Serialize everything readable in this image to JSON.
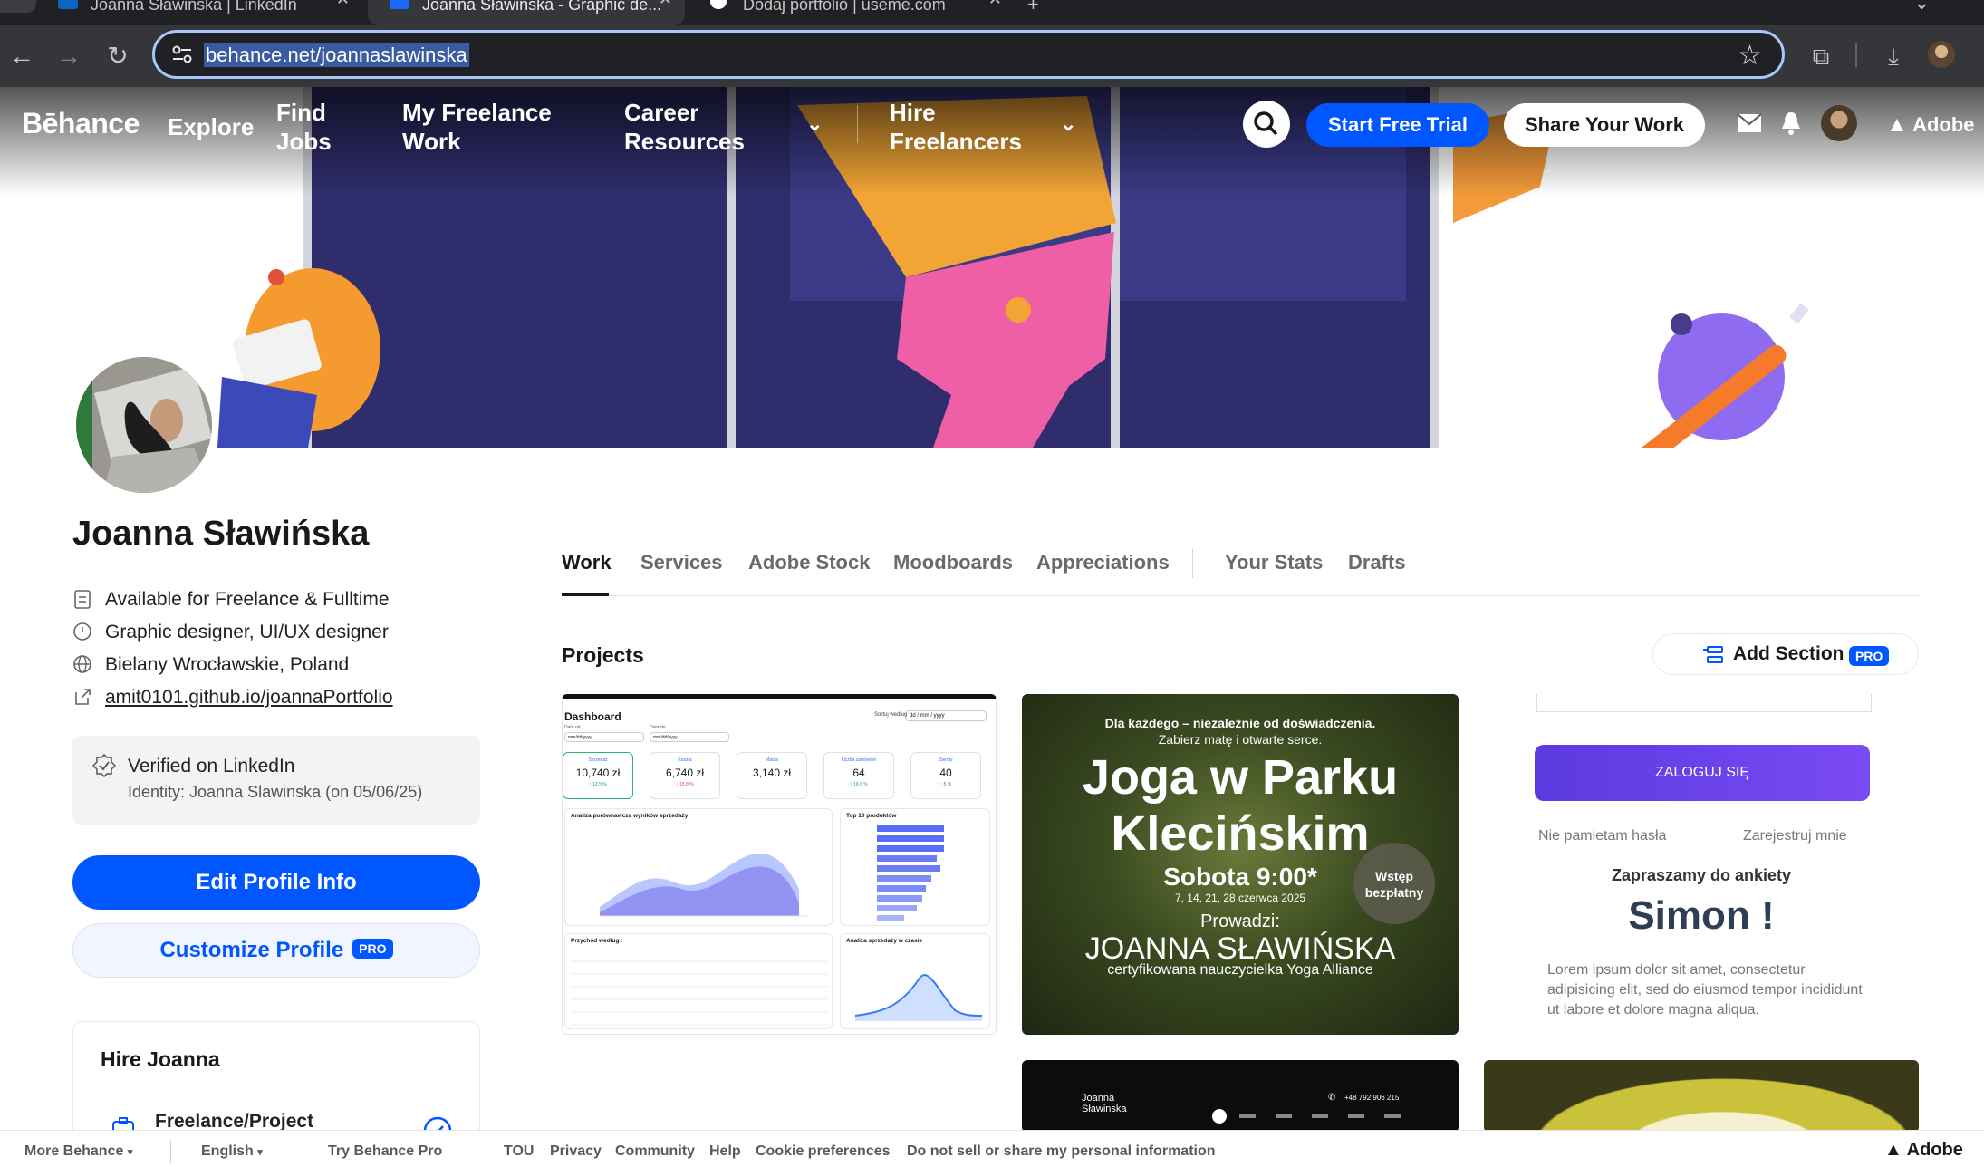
{
  "browser": {
    "tabs": [
      {
        "title": "Joanna Sławińska | LinkedIn"
      },
      {
        "title": "Joanna Sławińska - Graphic de..."
      },
      {
        "title": "Dodaj portfolio | useme.com"
      }
    ],
    "url": "behance.net/joannaslawinska",
    "icons": [
      "back-arrow-icon",
      "forward-arrow-icon",
      "reload-icon",
      "star-icon",
      "extensions-icon",
      "download-icon"
    ]
  },
  "behance_nav": {
    "logo": "Bēhance",
    "explore": "Explore",
    "find_jobs": [
      "Find",
      "Jobs"
    ],
    "freelance": [
      "My Freelance",
      "Work"
    ],
    "career": [
      "Career",
      "Resources"
    ],
    "hire": [
      "Hire",
      "Freelancers"
    ],
    "start_trial": "Start Free Trial",
    "share_work": "Share Your Work",
    "adobe": "Adobe"
  },
  "profile": {
    "name": "Joanna Sławińska",
    "availability": "Available for Freelance & Fulltime",
    "occupation": "Graphic designer, UI/UX designer",
    "location": "Bielany Wrocławskie, Poland",
    "website": "amit0101.github.io/joannaPortfolio",
    "verified_title": "Verified on LinkedIn",
    "verified_identity": "Identity: Joanna Slawinska (on 05/06/25)",
    "edit_button": "Edit Profile Info",
    "customize_button": "Customize Profile",
    "pro_badge": "PRO",
    "hire_title": "Hire Joanna",
    "hire_option": "Freelance/Project"
  },
  "tabs": {
    "items": [
      "Work",
      "Services",
      "Adobe Stock",
      "Moodboards",
      "Appreciations"
    ],
    "owner_items": [
      "Your Stats",
      "Drafts"
    ]
  },
  "projects": {
    "heading": "Projects",
    "add_section": "Add Section",
    "dashboard": {
      "title": "Dashboard",
      "sort_label": "Sortuj według",
      "sort_value": "dd / mm / yyyy",
      "date_from_label": "Data od",
      "date_from": "mm/dd/yyyy",
      "date_to_label": "Data do",
      "date_to": "mm/dd/yyyy",
      "kpis": [
        {
          "label": "Sprzedaż",
          "value": "10,740 zł",
          "delta": "↑ 12.5 %"
        },
        {
          "label": "Koszta",
          "value": "6,740 zł",
          "delta": "↓ 15.8 %"
        },
        {
          "label": "Marża",
          "value": "3,140 zł",
          "delta": ""
        },
        {
          "label": "Liczba zamówień",
          "value": "64",
          "delta": "↑ 16.6 %"
        },
        {
          "label": "Zwroty",
          "value": "40",
          "delta": "↑ 5 %"
        }
      ],
      "chart1_title": "Analiza porównawcza wyników sprzedaży",
      "chart2_title": "Top 10 produktów",
      "chart3_title": "Przychód według :",
      "chart4_title": "Analiza sprzedaży w czasie"
    },
    "yoga": {
      "line1": "Dla każdego – niezależnie od doświadczenia.",
      "line2": "Zabierz matę i otwarte serce.",
      "title1": "Joga w Parku",
      "title2": "Klecińskim",
      "time": "Sobota 9:00*",
      "dates": "7, 14, 21, 28 czerwca 2025",
      "badge1": "Wstęp",
      "badge2": "bezpłatny",
      "host_label": "Prowadzi:",
      "host_name": "JOANNA SŁAWIŃSKA",
      "host_desc": "certyfikowana nauczycielka Yoga Alliance"
    },
    "login": {
      "button": "ZALOGUJ SIĘ",
      "forgot": "Nie pamietam hasła",
      "register": "Zarejestruj mnie",
      "survey": "Zapraszamy do ankiety",
      "name": "Simon !",
      "lorem": "Lorem ipsum dolor sit amet, consectetur adipisicing elit, sed do eiusmod tempor incididunt ut labore et dolore magna aliqua."
    },
    "dark_card": {
      "name": "Joanna Sławinska",
      "phone": "+48 792 906 215"
    }
  },
  "footer": {
    "links": [
      "More Behance",
      "English",
      "Try Behance Pro",
      "TOU",
      "Privacy",
      "Community",
      "Help",
      "Cookie preferences",
      "Do not sell or share my personal information"
    ],
    "adobe": "Adobe"
  }
}
